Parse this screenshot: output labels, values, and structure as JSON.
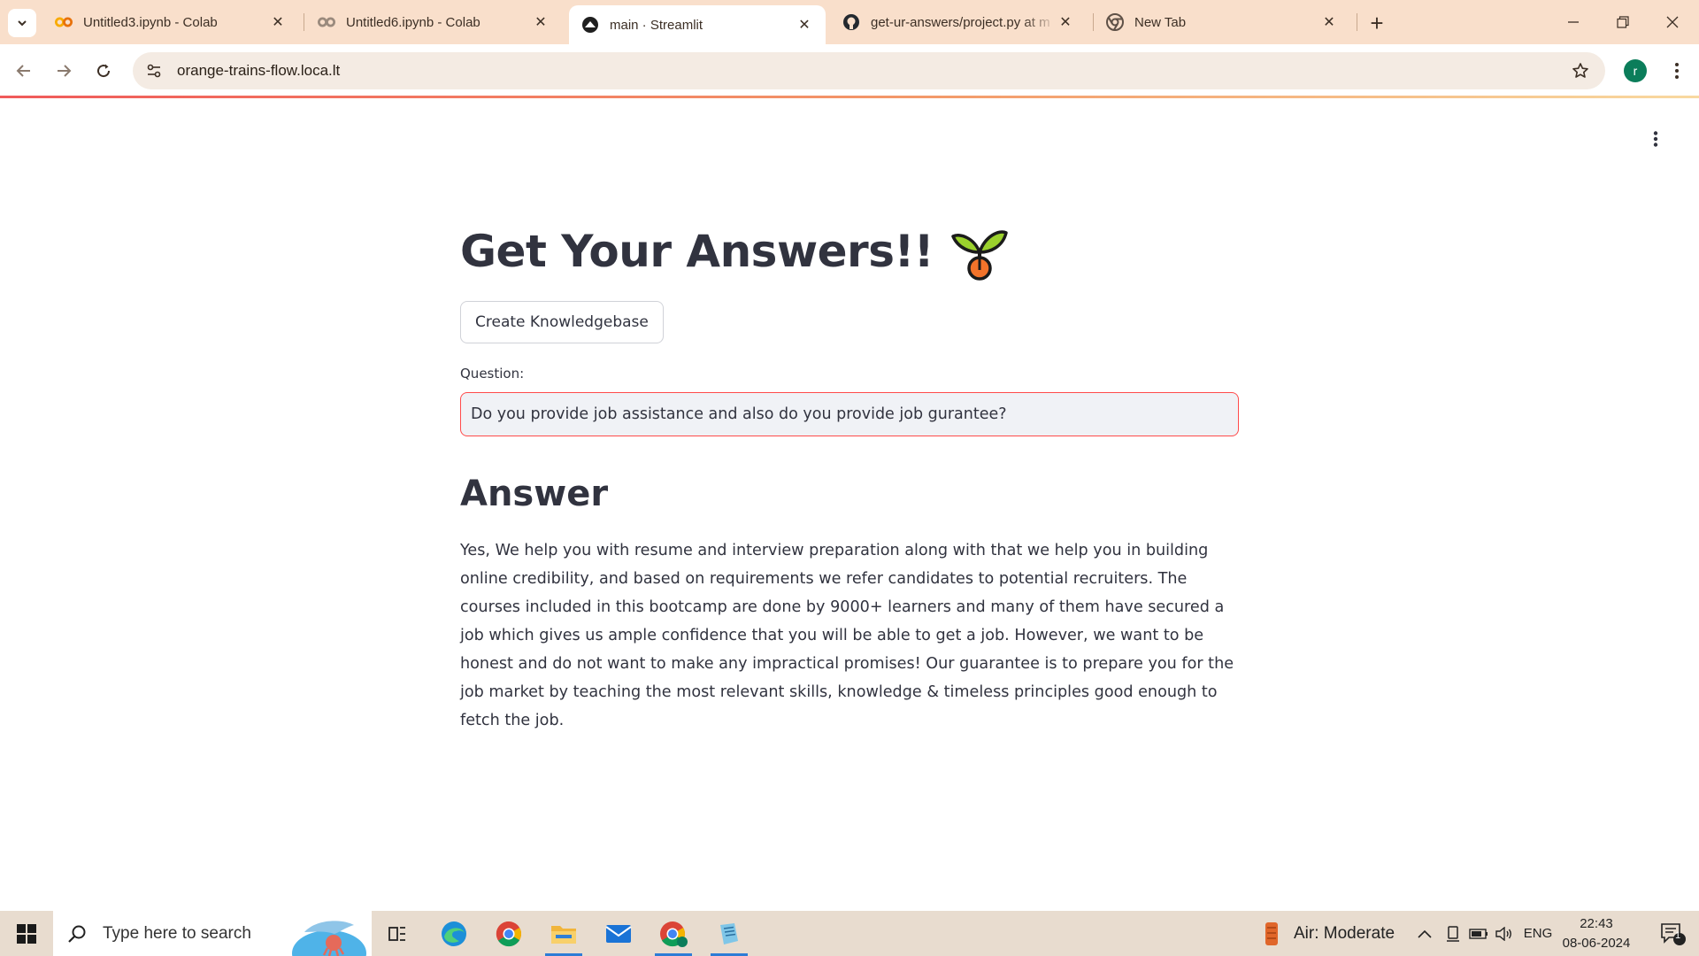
{
  "browser": {
    "tabs": [
      {
        "title": "Untitled3.ipynb - Colab",
        "favicon": "colab-icon",
        "active": false
      },
      {
        "title": "Untitled6.ipynb - Colab",
        "favicon": "colab-icon",
        "active": false
      },
      {
        "title": "main · Streamlit",
        "favicon": "streamlit-icon",
        "active": true
      },
      {
        "title": "get-ur-answers/project.py at m",
        "favicon": "github-icon",
        "active": false
      },
      {
        "title": "New Tab",
        "favicon": "chrome-icon",
        "active": false
      }
    ],
    "url": "orange-trains-flow.loca.lt",
    "profile_initial": "r",
    "accent_color": "#f9dfcb"
  },
  "app": {
    "title": "Get Your Answers!!",
    "title_emoji": "seedling-icon",
    "create_button_label": "Create Knowledgebase",
    "question_label": "Question:",
    "question_value": "Do you provide job assistance and also do you provide job gurantee?",
    "answer_heading": "Answer",
    "answer_text": "Yes, We help you with resume and interview preparation along with that we help you in building online credibility, and based on requirements we refer candidates to potential recruiters. The courses included in this bootcamp are done by 9000+ learners and many of them have secured a job which gives us ample confidence that you will be able to get a job. However, we want to be honest and do not want to make any impractical promises! Our guarantee is to prepare you for the job market by teaching the most relevant skills, knowledge & timeless principles good enough to fetch the job.",
    "input_border_color": "#ff4b4b"
  },
  "taskbar": {
    "search_placeholder": "Type here to search",
    "weather": "Air: Moderate",
    "language": "ENG",
    "time": "22:43",
    "date": "08-06-2024",
    "notification_count": "1"
  }
}
